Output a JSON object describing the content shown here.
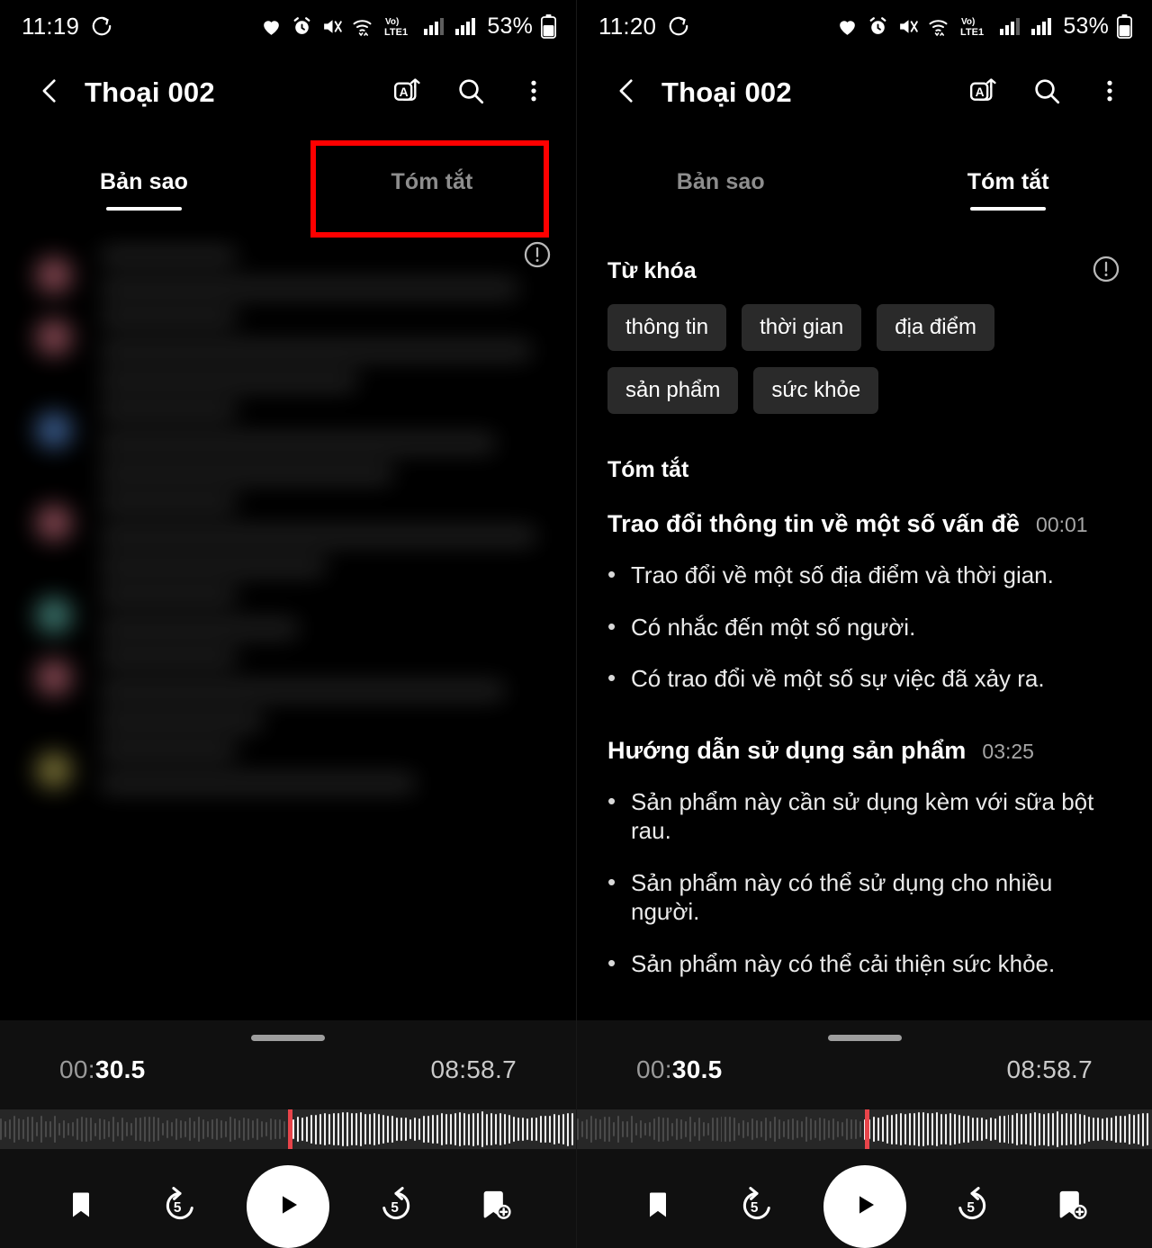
{
  "panels": [
    {
      "id": "left",
      "statusbar": {
        "time": "11:19",
        "battery_percent": "53%",
        "icons": [
          "heart-icon",
          "alarm-icon",
          "mute-vibrate-icon",
          "wifi-icon",
          "volte-lte1-icon",
          "signal-sim1-icon",
          "signal-sim2-icon",
          "battery-icon"
        ]
      },
      "appbar": {
        "title": "Thoại 002",
        "back_icon": "back-chevron-icon",
        "actions": [
          "translate-icon",
          "search-icon",
          "more-options-icon"
        ]
      },
      "tabs": [
        {
          "label": "Bản sao",
          "active": true
        },
        {
          "label": "Tóm tắt",
          "active": false,
          "highlighted": true
        }
      ],
      "info_icon": "info-exclamation-icon",
      "transcript_state": "blurred"
    },
    {
      "id": "right",
      "statusbar": {
        "time": "11:20",
        "battery_percent": "53%",
        "icons": [
          "heart-icon",
          "alarm-icon",
          "mute-vibrate-icon",
          "wifi-icon",
          "volte-lte1-icon",
          "signal-sim1-icon",
          "signal-sim2-icon",
          "battery-icon"
        ]
      },
      "appbar": {
        "title": "Thoại 002",
        "back_icon": "back-chevron-icon",
        "actions": [
          "translate-icon",
          "search-icon",
          "more-options-icon"
        ]
      },
      "tabs": [
        {
          "label": "Bản sao",
          "active": false
        },
        {
          "label": "Tóm tắt",
          "active": true
        }
      ],
      "summary": {
        "keywords_title": "Từ khóa",
        "info_icon": "info-exclamation-icon",
        "keywords": [
          "thông tin",
          "thời gian",
          "địa điểm",
          "sản phẩm",
          "sức khỏe"
        ],
        "summary_title": "Tóm tắt",
        "topics": [
          {
            "title": "Trao đổi thông tin về một số vấn đề",
            "time": "00:01",
            "bullets": [
              "Trao đổi về một số địa điểm và thời gian.",
              "Có nhắc đến một số người.",
              "Có trao đổi về một số sự việc đã xảy ra."
            ]
          },
          {
            "title": "Hướng dẫn sử dụng sản phẩm",
            "time": "03:25",
            "bullets": [
              "Sản phẩm này cần sử dụng kèm với sữa bột rau.",
              "Sản phẩm này có thể sử dụng cho nhiều người.",
              "Sản phẩm này có thể cải thiện sức khỏe."
            ]
          }
        ]
      }
    }
  ],
  "player": {
    "current_time": "00:",
    "current_time_bold": "30.5",
    "total_time": "08:58.7",
    "playhead_percent": 50,
    "controls": [
      "bookmark-icon",
      "rewind-5-icon",
      "play-icon",
      "forward-5-icon",
      "add-bookmark-icon"
    ],
    "rewind_label": "5",
    "forward_label": "5"
  },
  "colors": {
    "highlight_box": "#fe0000",
    "playhead": "#e8444a",
    "chip_bg": "#2a2a2a",
    "accent_text": "#ffffff",
    "muted_text": "#8d8d8d"
  }
}
